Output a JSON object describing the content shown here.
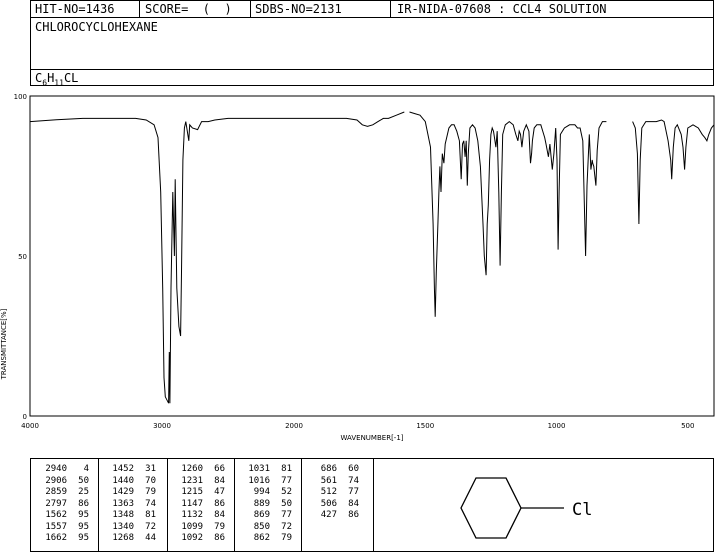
{
  "header": {
    "hit_no": "HIT-NO=1436",
    "score": "SCORE=  (  )",
    "sdbs_no": "SDBS-NO=2131",
    "ir_id": "IR-NIDA-07608 : CCL4 SOLUTION"
  },
  "compound": {
    "name": "CHLOROCYCLOHEXANE",
    "formula": {
      "c": "C",
      "c_sub": "6",
      "h": "H",
      "h_sub": "11",
      "rest": "CL"
    }
  },
  "structure": {
    "label": "Cl"
  },
  "chart_data": {
    "type": "line",
    "xlabel": "WAVENUMBER[-1]",
    "ylabel": "TRANSMITTANCE[%]",
    "xlim": [
      4000,
      400
    ],
    "ylim": [
      0,
      100
    ],
    "x_ticks": [
      4000,
      3000,
      2000,
      1500,
      1000,
      500
    ],
    "y_ticks": [
      0,
      50,
      100
    ],
    "series": [
      {
        "segments": [
          [
            [
              4000,
              92
            ],
            [
              3800,
              92.6
            ],
            [
              3600,
              93
            ],
            [
              3400,
              93
            ],
            [
              3200,
              93
            ],
            [
              3120,
              92.5
            ],
            [
              3060,
              91
            ],
            [
              3030,
              87
            ],
            [
              3010,
              70
            ],
            [
              2995,
              40
            ],
            [
              2985,
              12
            ],
            [
              2975,
              6
            ],
            [
              2950,
              4
            ],
            [
              2945,
              20
            ],
            [
              2940,
              4
            ],
            [
              2932,
              40
            ],
            [
              2918,
              70
            ],
            [
              2906,
              50
            ],
            [
              2900,
              74
            ],
            [
              2888,
              40
            ],
            [
              2872,
              28
            ],
            [
              2859,
              25
            ],
            [
              2852,
              45
            ],
            [
              2842,
              80
            ],
            [
              2830,
              90
            ],
            [
              2820,
              92
            ],
            [
              2797,
              86
            ],
            [
              2790,
              91
            ],
            [
              2770,
              90
            ],
            [
              2730,
              89.5
            ],
            [
              2700,
              92
            ],
            [
              2650,
              92
            ],
            [
              2600,
              92.5
            ],
            [
              2500,
              93
            ],
            [
              2400,
              93
            ],
            [
              2300,
              93
            ],
            [
              2200,
              93
            ],
            [
              2100,
              93
            ],
            [
              2000,
              93
            ],
            [
              1900,
              93
            ],
            [
              1800,
              93
            ],
            [
              1760,
              92.5
            ],
            [
              1740,
              91
            ],
            [
              1720,
              90.5
            ],
            [
              1700,
              91
            ],
            [
              1680,
              92
            ],
            [
              1660,
              93
            ],
            [
              1640,
              93
            ],
            [
              1610,
              94
            ],
            [
              1580,
              95
            ]
          ],
          [
            [
              1560,
              95
            ],
            [
              1540,
              94.5
            ],
            [
              1520,
              94
            ],
            [
              1500,
              92
            ],
            [
              1490,
              88
            ],
            [
              1480,
              84
            ],
            [
              1470,
              60
            ],
            [
              1465,
              40
            ],
            [
              1462,
              31
            ],
            [
              1458,
              45
            ],
            [
              1452,
              60
            ],
            [
              1448,
              70
            ],
            [
              1444,
              78
            ],
            [
              1440,
              70
            ],
            [
              1435,
              82
            ],
            [
              1429,
              79
            ],
            [
              1424,
              85
            ],
            [
              1410,
              90
            ],
            [
              1400,
              91
            ],
            [
              1390,
              91
            ],
            [
              1380,
              89
            ],
            [
              1370,
              86
            ],
            [
              1363,
              74
            ],
            [
              1358,
              85
            ],
            [
              1353,
              86
            ],
            [
              1348,
              81
            ],
            [
              1344,
              86
            ],
            [
              1340,
              72
            ],
            [
              1336,
              82
            ],
            [
              1330,
              90
            ],
            [
              1320,
              91
            ],
            [
              1310,
              90
            ],
            [
              1300,
              86
            ],
            [
              1290,
              78
            ],
            [
              1280,
              60
            ],
            [
              1275,
              50
            ],
            [
              1268,
              44
            ],
            [
              1264,
              60
            ],
            [
              1260,
              66
            ],
            [
              1255,
              80
            ],
            [
              1250,
              88
            ],
            [
              1245,
              90
            ],
            [
              1240,
              89
            ],
            [
              1231,
              84
            ],
            [
              1226,
              89
            ],
            [
              1220,
              70
            ],
            [
              1215,
              47
            ],
            [
              1210,
              70
            ],
            [
              1205,
              88
            ],
            [
              1195,
              91
            ],
            [
              1180,
              92
            ],
            [
              1165,
              91
            ],
            [
              1155,
              88
            ],
            [
              1147,
              86
            ],
            [
              1142,
              89
            ],
            [
              1137,
              88
            ],
            [
              1132,
              84
            ],
            [
              1125,
              89
            ],
            [
              1115,
              91
            ],
            [
              1105,
              89
            ],
            [
              1099,
              79
            ],
            [
              1095,
              82
            ],
            [
              1092,
              86
            ],
            [
              1085,
              90
            ],
            [
              1075,
              91
            ],
            [
              1060,
              91
            ],
            [
              1045,
              87
            ],
            [
              1040,
              85
            ],
            [
              1031,
              81
            ],
            [
              1025,
              85
            ],
            [
              1016,
              77
            ],
            [
              1010,
              82
            ],
            [
              1003,
              90
            ],
            [
              998,
              80
            ],
            [
              994,
              52
            ],
            [
              990,
              70
            ],
            [
              985,
              88
            ],
            [
              970,
              90
            ],
            [
              950,
              91
            ],
            [
              930,
              91
            ],
            [
              920,
              90
            ],
            [
              910,
              90
            ],
            [
              900,
              86
            ],
            [
              889,
              50
            ],
            [
              884,
              72
            ],
            [
              875,
              88
            ],
            [
              869,
              77
            ],
            [
              864,
              80
            ],
            [
              862,
              79
            ],
            [
              858,
              78
            ],
            [
              850,
              72
            ],
            [
              845,
              83
            ],
            [
              838,
              90
            ],
            [
              825,
              92
            ],
            [
              810,
              92
            ]
          ],
          [
            [
              710,
              92
            ],
            [
              700,
              90
            ],
            [
              692,
              82
            ],
            [
              686,
              60
            ],
            [
              681,
              80
            ],
            [
              675,
              90
            ],
            [
              660,
              92
            ],
            [
              640,
              92
            ],
            [
              620,
              92
            ],
            [
              600,
              92.5
            ],
            [
              590,
              92
            ],
            [
              575,
              86
            ],
            [
              565,
              80
            ],
            [
              561,
              74
            ],
            [
              555,
              84
            ],
            [
              548,
              90
            ],
            [
              540,
              91
            ],
            [
              525,
              88
            ],
            [
              518,
              84
            ],
            [
              512,
              77
            ],
            [
              507,
              84
            ],
            [
              500,
              90
            ],
            [
              480,
              91
            ],
            [
              460,
              90
            ],
            [
              445,
              88
            ],
            [
              435,
              87
            ],
            [
              427,
              86
            ],
            [
              420,
              88
            ],
            [
              410,
              90
            ],
            [
              400,
              91
            ]
          ]
        ]
      }
    ]
  },
  "peak_table": [
    [
      [
        "2940",
        "4"
      ],
      [
        "2906",
        "50"
      ],
      [
        "2859",
        "25"
      ],
      [
        "2797",
        "86"
      ],
      [
        "1562",
        "95"
      ],
      [
        "1557",
        "95"
      ],
      [
        "1662",
        "95"
      ]
    ],
    [
      [
        "1452",
        "31"
      ],
      [
        "1440",
        "70"
      ],
      [
        "1429",
        "79"
      ],
      [
        "1363",
        "74"
      ],
      [
        "1348",
        "81"
      ],
      [
        "1340",
        "72"
      ],
      [
        "1268",
        "44"
      ]
    ],
    [
      [
        "1260",
        "66"
      ],
      [
        "1231",
        "84"
      ],
      [
        "1215",
        "47"
      ],
      [
        "1147",
        "86"
      ],
      [
        "1132",
        "84"
      ],
      [
        "1099",
        "79"
      ],
      [
        "1092",
        "86"
      ]
    ],
    [
      [
        "1031",
        "81"
      ],
      [
        "1016",
        "77"
      ],
      [
        "994",
        "52"
      ],
      [
        "889",
        "50"
      ],
      [
        "869",
        "77"
      ],
      [
        "850",
        "72"
      ],
      [
        "862",
        "79"
      ]
    ],
    [
      [
        "686",
        "60"
      ],
      [
        "561",
        "74"
      ],
      [
        "512",
        "77"
      ],
      [
        "506",
        "84"
      ],
      [
        "427",
        "86"
      ]
    ]
  ]
}
